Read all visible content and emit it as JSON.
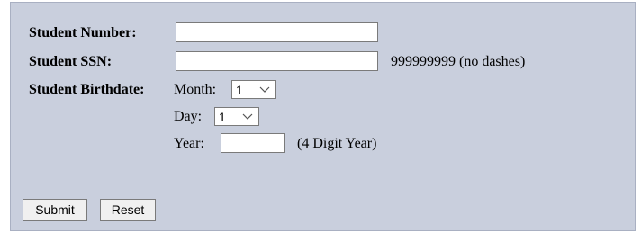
{
  "form": {
    "student_number_label": "Student Number:",
    "student_number_value": "",
    "student_ssn_label": "Student SSN:",
    "student_ssn_value": "",
    "ssn_hint": "999999999 (no dashes)",
    "birthdate_label": "Student Birthdate:",
    "month_label": "Month:",
    "month_value": "1",
    "day_label": "Day:",
    "day_value": "1",
    "year_label": "Year:",
    "year_value": "",
    "year_hint": "(4 Digit Year)"
  },
  "buttons": {
    "submit_label": "Submit",
    "reset_label": "Reset"
  },
  "icons": {
    "dropdown": "chevron-down-icon"
  },
  "colors": {
    "panel_background": "#c9cfdd",
    "input_background": "#ffffff"
  }
}
